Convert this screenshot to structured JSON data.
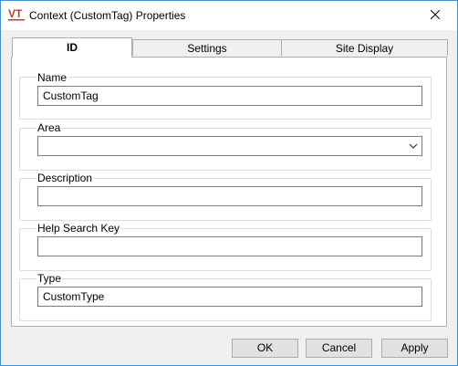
{
  "window": {
    "title": "Context (CustomTag) Properties",
    "icon": "vt-app-icon",
    "close_icon": "close-icon"
  },
  "tabs": [
    {
      "label": "ID",
      "active": true
    },
    {
      "label": "Settings",
      "active": false
    },
    {
      "label": "Site Display",
      "active": false
    }
  ],
  "fields": {
    "name": {
      "label": "Name",
      "value": "CustomTag"
    },
    "area": {
      "label": "Area",
      "value": ""
    },
    "description": {
      "label": "Description",
      "value": ""
    },
    "help_search_key": {
      "label": "Help Search Key",
      "value": ""
    },
    "type": {
      "label": "Type",
      "value": "CustomType"
    }
  },
  "buttons": {
    "ok": "OK",
    "cancel": "Cancel",
    "apply": "Apply"
  }
}
